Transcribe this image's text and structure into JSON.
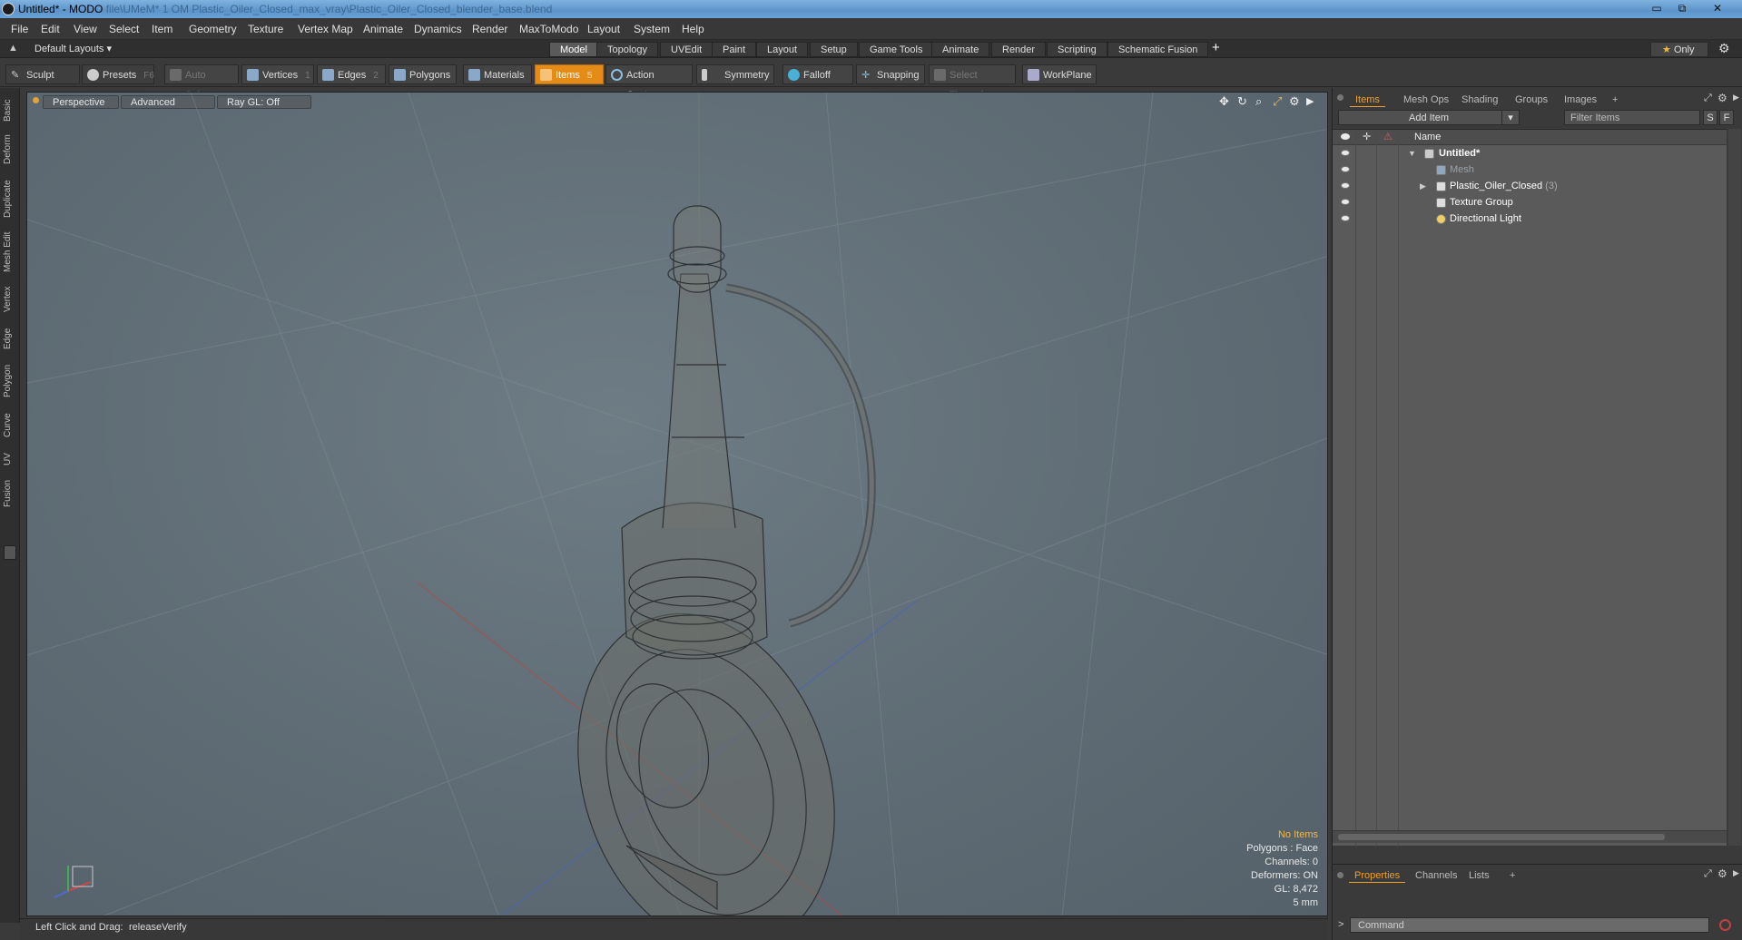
{
  "window": {
    "title": "Untitled* - MODO",
    "title_dim": "file\\UMeM* 1 OM Plastic_Oiler_Closed_max_vray\\Plastic_Oiler_Closed_blender_base.blend",
    "minimize": "▭",
    "restore": "⧉",
    "close": "✕"
  },
  "menu": [
    "File",
    "Edit",
    "View",
    "Select",
    "Item",
    "Geometry",
    "Texture",
    "Vertex Map",
    "Animate",
    "Dynamics",
    "Render",
    "MaxToModo",
    "Layout",
    "System",
    "Help"
  ],
  "layoutbar": {
    "layouts_label": "Default Layouts",
    "tabs": [
      "Model",
      "Topology",
      "UVEdit",
      "Paint",
      "Layout",
      "Setup",
      "Game Tools",
      "Animate",
      "Render",
      "Scripting",
      "Schematic Fusion"
    ],
    "active_tab": "Model",
    "add": "+",
    "only_label": "Only",
    "star": "★"
  },
  "toolbar": {
    "sculpt": "Sculpt",
    "presets": "Presets",
    "presets_key": "F6",
    "auto_select": "Auto Select",
    "vertices": "Vertices",
    "vertices_key": "1",
    "edges": "Edges",
    "edges_key": "2",
    "polygons": "Polygons",
    "materials": "Materials",
    "items": "Items",
    "items_key": "5",
    "action_center": "Action Center",
    "symmetry": "Symmetry",
    "falloff": "Falloff",
    "snapping": "Snapping",
    "select_through": "Select Through",
    "workplane": "WorkPlane"
  },
  "left_tabs": [
    "Basic",
    "Deform",
    "Duplicate",
    "Mesh Edit",
    "Vertex",
    "Edge",
    "Polygon",
    "Curve",
    "UV",
    "Fusion"
  ],
  "viewport": {
    "perspective": "Perspective",
    "advanced": "Advanced",
    "raygl": "Ray GL: Off",
    "info": {
      "no_items": "No Items",
      "polygons": "Polygons : Face",
      "channels": "Channels: 0",
      "deformers": "Deformers: ON",
      "gl": "GL: 8,472",
      "scale": "5 mm"
    }
  },
  "status": {
    "hint_label": "Left Click and Drag:",
    "hint_value": "releaseVerify"
  },
  "items_panel": {
    "tabs": [
      "Items",
      "Mesh Ops",
      "Shading",
      "Groups",
      "Images"
    ],
    "active_tab": "Items",
    "add_tab": "+",
    "add_item": "Add Item",
    "filter_placeholder": "Filter Items",
    "s_btn": "S",
    "f_btn": "F",
    "name_header": "Name",
    "rows": [
      {
        "label": "Untitled*",
        "count": ""
      },
      {
        "label": "Mesh",
        "count": ""
      },
      {
        "label": "Plastic_Oiler_Closed",
        "count": "(3)"
      },
      {
        "label": "Texture Group",
        "count": ""
      },
      {
        "label": "Directional Light",
        "count": ""
      }
    ]
  },
  "props_panel": {
    "tabs": [
      "Properties",
      "Channels",
      "Lists"
    ],
    "active_tab": "Properties",
    "add_tab": "+",
    "cmd_prompt": ">",
    "cmd_placeholder": "Command"
  }
}
